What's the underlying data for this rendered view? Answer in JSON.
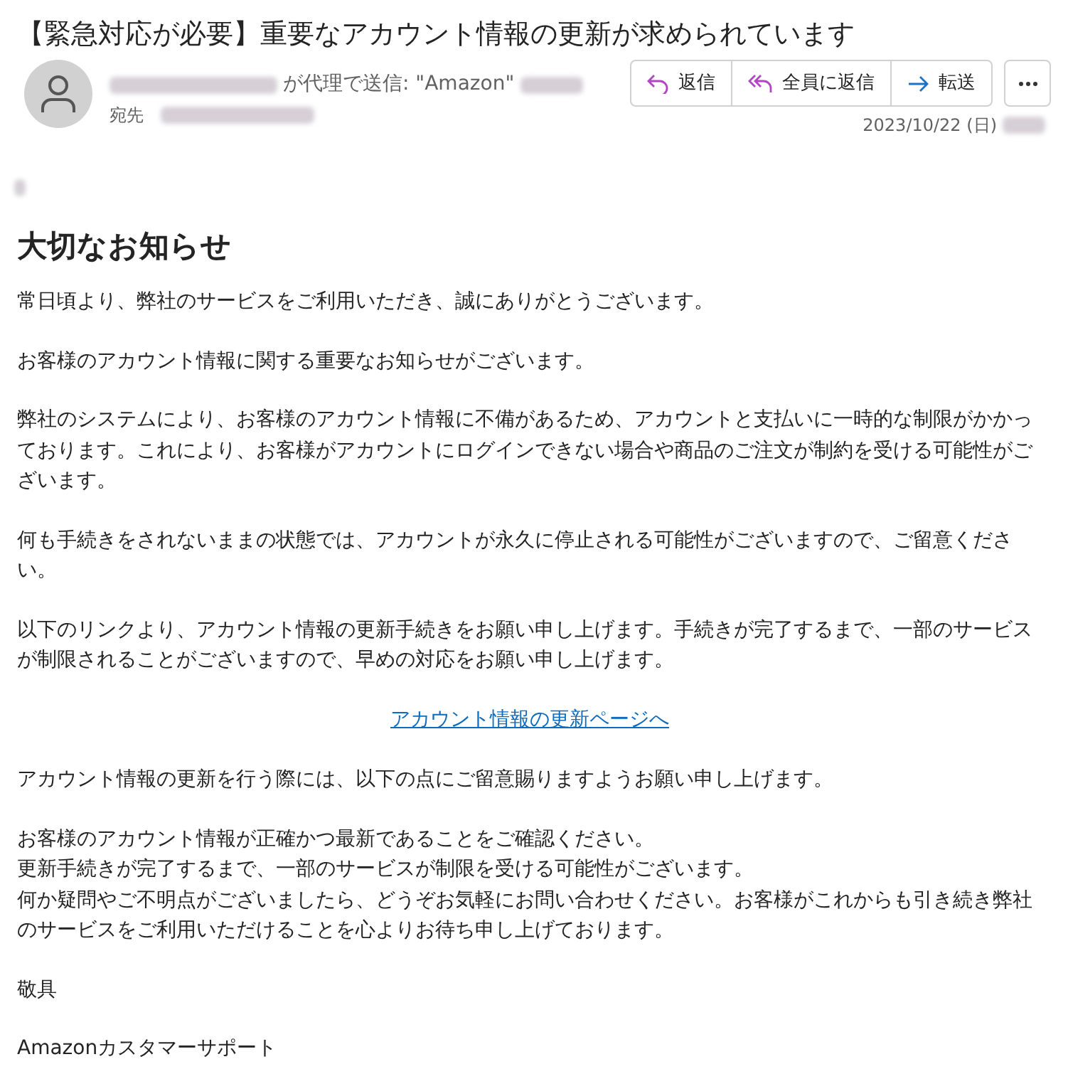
{
  "subject": "【緊急対応が必要】重要なアカウント情報の更新が求められています",
  "sender": {
    "on_behalf": "が代理で送信: \"Amazon\"",
    "to_label": "宛先"
  },
  "actions": [
    {
      "kind": "reply",
      "label": "返信"
    },
    {
      "kind": "reply-all",
      "label": "全員に返信"
    },
    {
      "kind": "forward",
      "label": "転送"
    }
  ],
  "date": "2023/10/22 (日)",
  "body": {
    "heading": "大切なお知らせ",
    "blocks": [
      {
        "kind": "text",
        "lines": [
          "常日頃より、弊社のサービスをご利用いただき、誠にありがとうございます。"
        ]
      },
      {
        "kind": "text",
        "lines": [
          "お客様のアカウント情報に関する重要なお知らせがございます。"
        ]
      },
      {
        "kind": "text",
        "lines": [
          "弊社のシステムにより、お客様のアカウント情報に不備があるため、アカウントと支払いに一時的な制限がかかっております。これにより、お客様がアカウントにログインできない場合や商品のご注文が制約を受ける可能性がございます。"
        ]
      },
      {
        "kind": "text",
        "lines": [
          "何も手続きをされないままの状態では、アカウントが永久に停止される可能性がございますので、ご留意ください。"
        ]
      },
      {
        "kind": "text",
        "lines": [
          "以下のリンクより、アカウント情報の更新手続きをお願い申し上げます。手続きが完了するまで、一部のサービスが制限されることがございますので、早めの対応をお願い申し上げます。"
        ]
      },
      {
        "kind": "link",
        "lines": [
          "アカウント情報の更新ページへ"
        ]
      },
      {
        "kind": "text",
        "lines": [
          "アカウント情報の更新を行う際には、以下の点にご留意賜りますようお願い申し上げます。"
        ]
      },
      {
        "kind": "text",
        "lines": [
          "お客様のアカウント情報が正確かつ最新であることをご確認ください。",
          "更新手続きが完了するまで、一部のサービスが制限を受ける可能性がございます。",
          "何か疑問やご不明点がございましたら、どうぞお気軽にお問い合わせください。お客様がこれからも引き続き弊社のサービスをご利用いただけることを心よりお待ち申し上げております。"
        ]
      },
      {
        "kind": "text",
        "lines": [
          "敬具"
        ]
      },
      {
        "kind": "text",
        "lines": [
          "Amazonカスタマーサポート"
        ]
      }
    ]
  }
}
